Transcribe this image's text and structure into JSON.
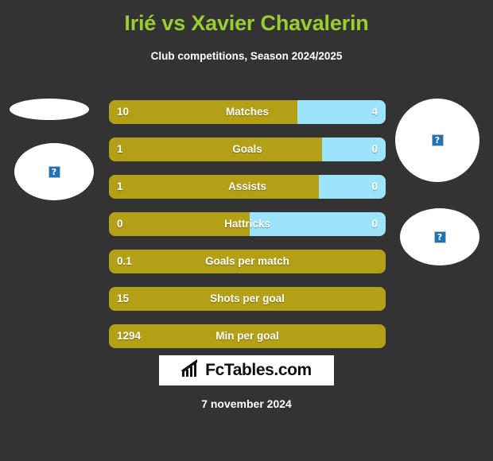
{
  "header": {
    "title": "Irié vs Xavier Chavalerin",
    "subtitle": "Club competitions, Season 2024/2025"
  },
  "colors": {
    "background": "#333333",
    "title": "#9ACD32",
    "player_left": "#B3A017",
    "player_right": "#9BE4FB",
    "text": "#ffffff"
  },
  "side_images": {
    "left_flag_alt": "?",
    "left_photo_alt": "?",
    "right_photo_alt": "?",
    "right_flag_alt": "?"
  },
  "chart_data": {
    "type": "bar",
    "title": "Irié vs Xavier Chavalerin",
    "subtitle": "Club competitions, Season 2024/2025",
    "orientation": "horizontal-diverging",
    "series": [
      {
        "name": "Irié",
        "color": "#B3A017",
        "values": [
          10,
          1,
          1,
          0,
          0.1,
          15,
          1294
        ]
      },
      {
        "name": "Xavier Chavalerin",
        "color": "#9BE4FB",
        "values": [
          4,
          0,
          0,
          0,
          null,
          null,
          null
        ]
      }
    ],
    "categories": [
      "Matches",
      "Goals",
      "Assists",
      "Hattricks",
      "Goals per match",
      "Shots per goal",
      "Min per goal"
    ],
    "rows": [
      {
        "label": "Matches",
        "left": "10",
        "right": "4",
        "left_pct": 68,
        "has_right": true
      },
      {
        "label": "Goals",
        "left": "1",
        "right": "0",
        "left_pct": 77,
        "has_right": true
      },
      {
        "label": "Assists",
        "left": "1",
        "right": "0",
        "left_pct": 76,
        "has_right": true
      },
      {
        "label": "Hattricks",
        "left": "0",
        "right": "0",
        "left_pct": 51,
        "has_right": true
      },
      {
        "label": "Goals per match",
        "left": "0.1",
        "right": "",
        "left_pct": 100,
        "has_right": false
      },
      {
        "label": "Shots per goal",
        "left": "15",
        "right": "",
        "left_pct": 100,
        "has_right": false
      },
      {
        "label": "Min per goal",
        "left": "1294",
        "right": "",
        "left_pct": 100,
        "has_right": false
      }
    ],
    "grid": false,
    "legend": "none"
  },
  "footer": {
    "logo_text": "FcTables.com",
    "logo_icon": "bar-chart-icon",
    "date": "7 november 2024"
  }
}
